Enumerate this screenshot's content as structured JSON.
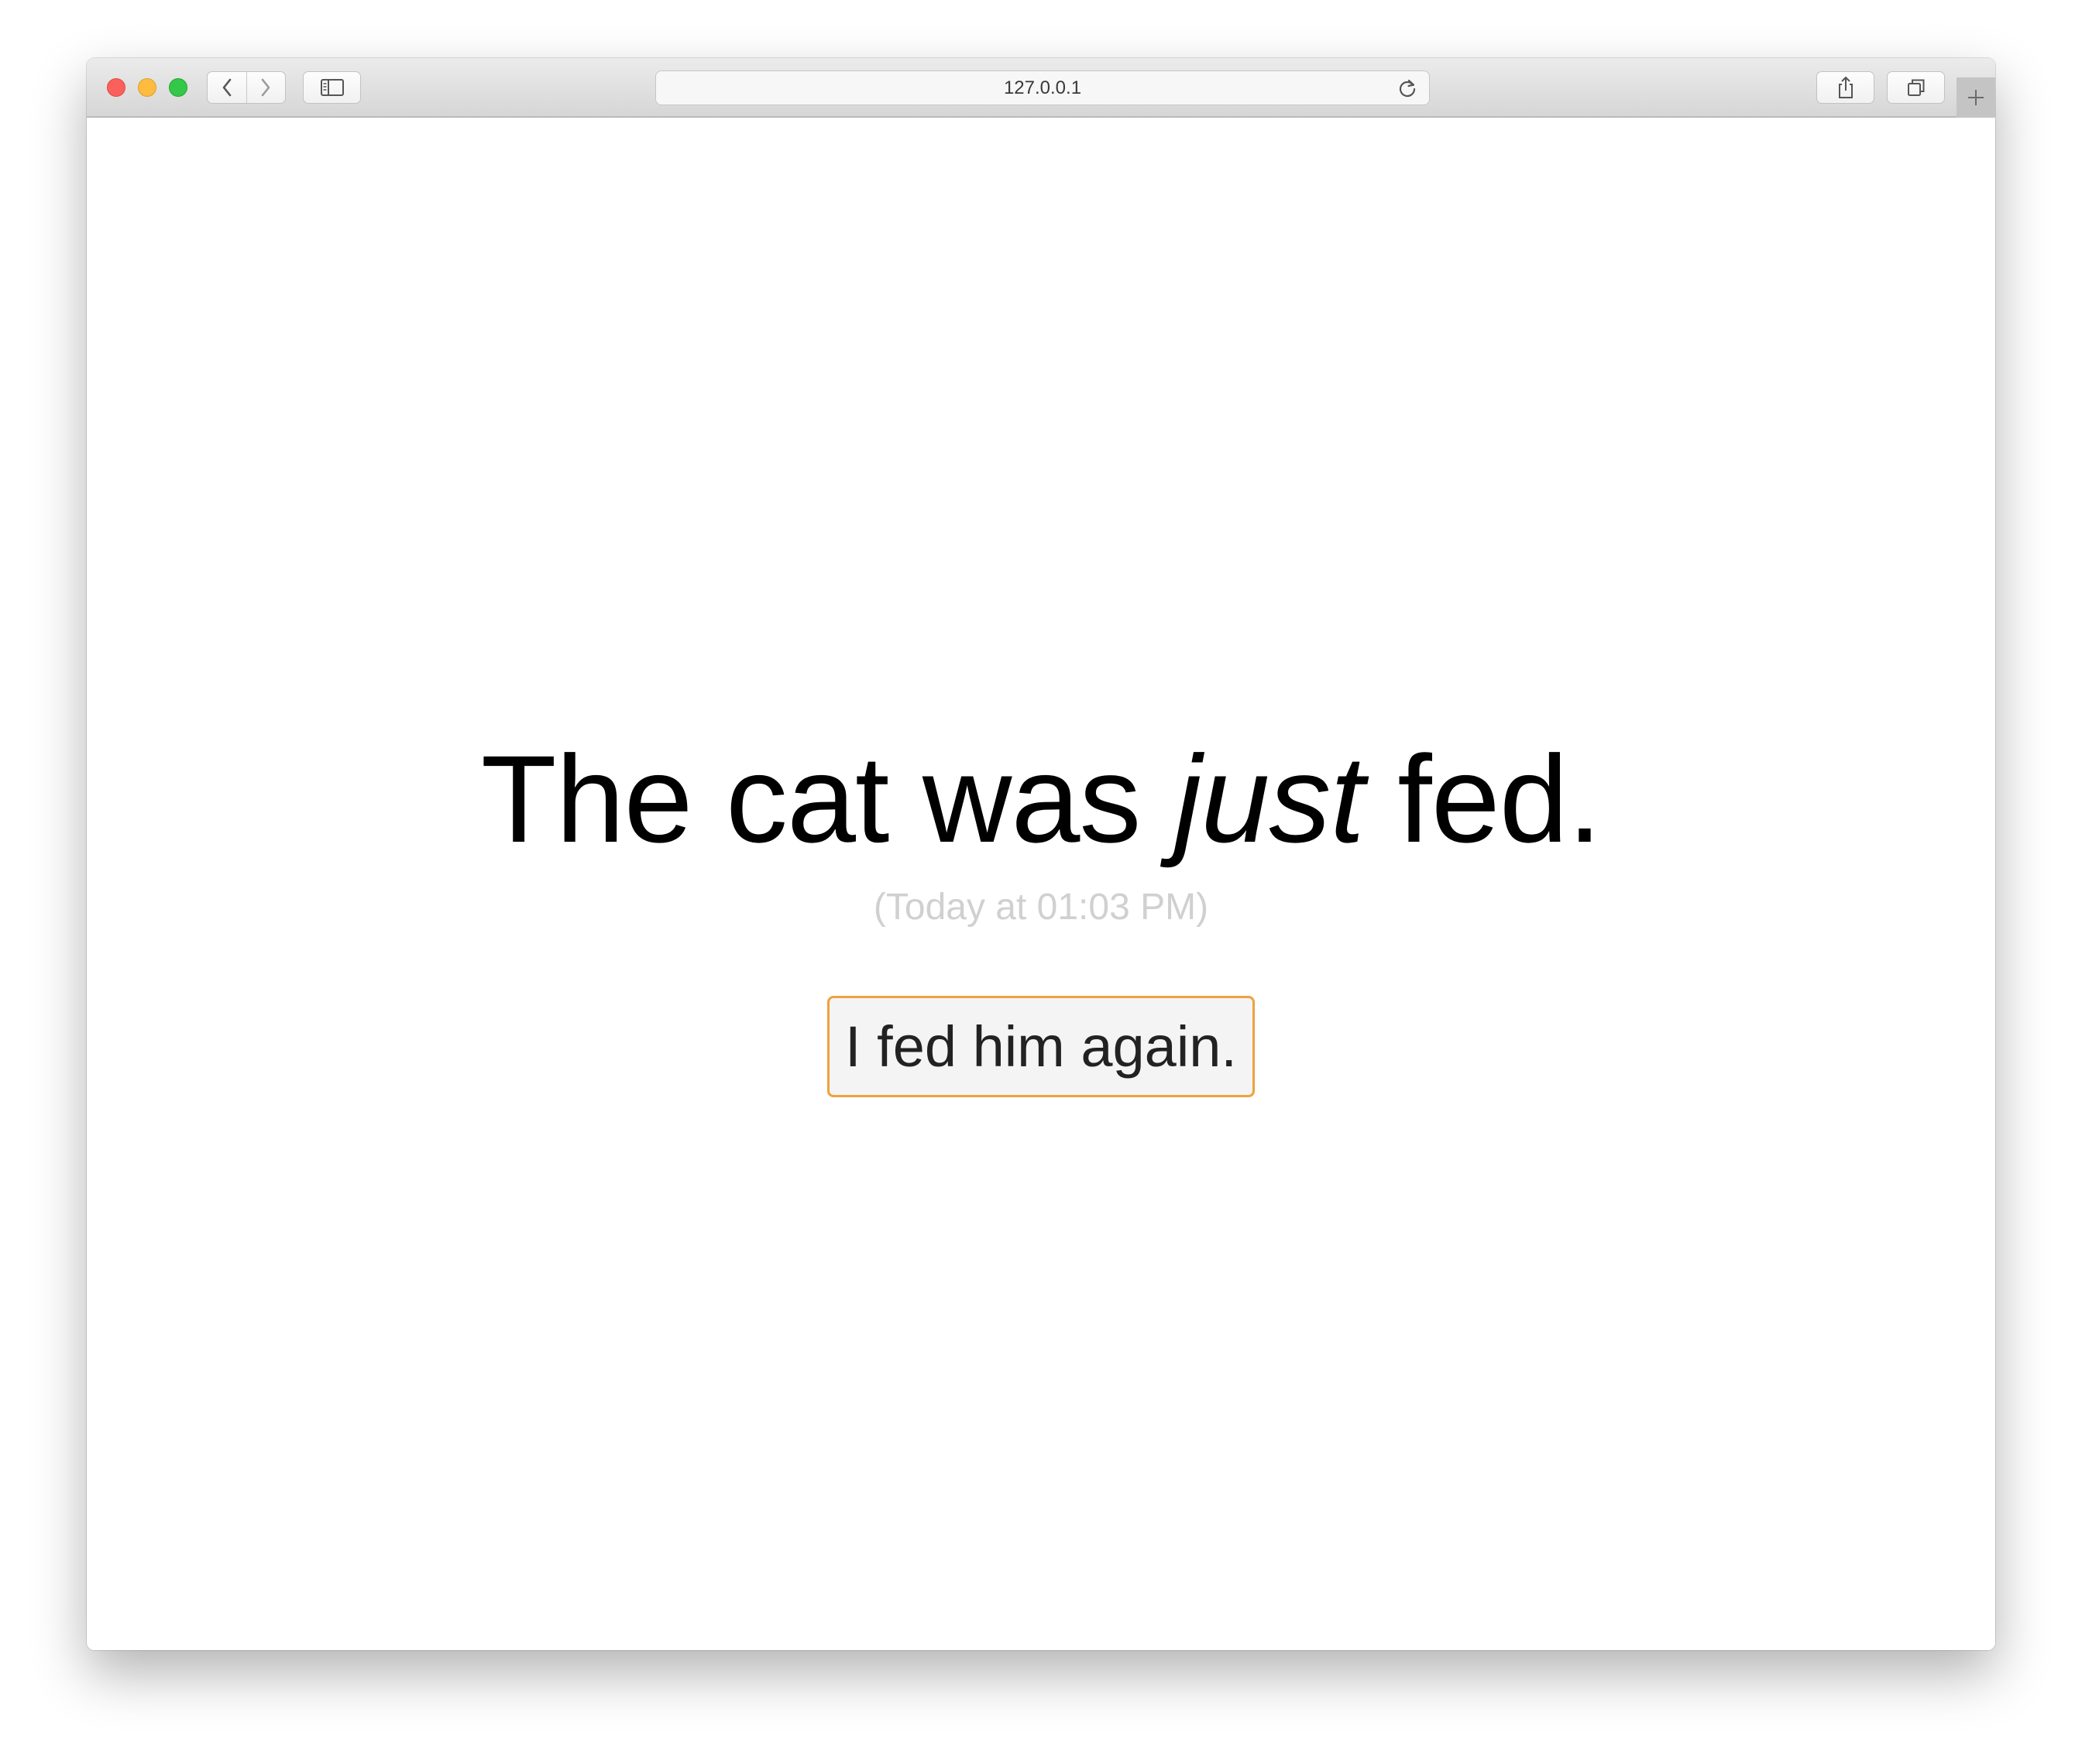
{
  "browser": {
    "address": "127.0.0.1",
    "icons": {
      "back": "chevron-left-icon",
      "forward": "chevron-right-icon",
      "sidebar": "sidebar-icon",
      "reload": "reload-icon",
      "share": "share-icon",
      "tabs": "tabs-overview-icon",
      "new_tab": "plus-icon"
    }
  },
  "page": {
    "headline_before": "The cat was ",
    "headline_emphasis": "just",
    "headline_after": " fed.",
    "timestamp": "(Today at 01:03 PM)",
    "action_label": "I fed him again."
  },
  "colors": {
    "button_border": "#efa23f",
    "timestamp_text": "#d0d0d0",
    "close": "#fc605c",
    "minimize": "#fdbc40",
    "maximize": "#34c84a"
  }
}
